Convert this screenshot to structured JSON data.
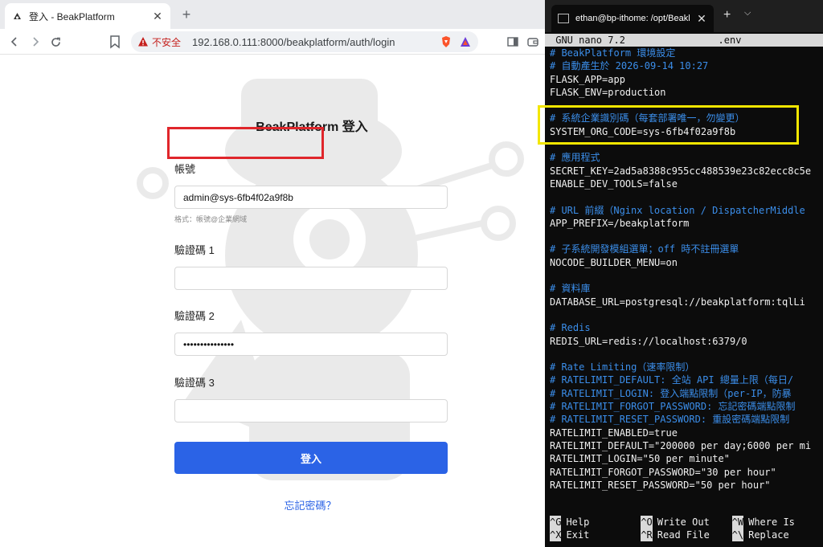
{
  "browser": {
    "tab_title": "登入 - BeakPlatform",
    "tab_close": "✕",
    "new_tab": "+",
    "insecure_label": "不安全",
    "url": "192.168.0.111:8000/beakplatform/auth/login"
  },
  "login": {
    "title": "BeakPlatform 登入",
    "account_label": "帳號",
    "account_value": "admin@sys-6fb4f02a9f8b",
    "account_hint": "格式：帳號@企業網域",
    "code1_label": "驗證碼 1",
    "code1_value": "",
    "code2_label": "驗證碼 2",
    "code2_value": "•••••••••••••••",
    "code3_label": "驗證碼 3",
    "code3_value": "",
    "submit_label": "登入",
    "forgot_label": "忘記密碼？"
  },
  "terminal": {
    "tab_title": "ethan@bp-ithome: /opt/Beakl",
    "tab_close": "✕",
    "new_tab": "+",
    "dropdown": "⌵",
    "nano_header": " GNU nano 7.2                .env",
    "lines": [
      {
        "text": "# BeakPlatform 環境設定",
        "kind": "comment"
      },
      {
        "text": "# 自動產生於 2026-09-14 10:27",
        "kind": "comment"
      },
      {
        "text": "FLASK_APP=app",
        "kind": "plain"
      },
      {
        "text": "FLASK_ENV=production",
        "kind": "plain"
      },
      {
        "text": "",
        "kind": "plain"
      },
      {
        "text": "# 系統企業識別碼（每套部署唯一，勿變更）",
        "kind": "comment"
      },
      {
        "text": "SYSTEM_ORG_CODE=sys-6fb4f02a9f8b",
        "kind": "plain"
      },
      {
        "text": "",
        "kind": "plain"
      },
      {
        "text": "# 應用程式",
        "kind": "comment"
      },
      {
        "text": "SECRET_KEY=2ad5a8388c955cc488539e23c82ecc8c5e",
        "kind": "plain"
      },
      {
        "text": "ENABLE_DEV_TOOLS=false",
        "kind": "plain"
      },
      {
        "text": "",
        "kind": "plain"
      },
      {
        "text": "# URL 前綴（Nginx location / DispatcherMiddle",
        "kind": "comment"
      },
      {
        "text": "APP_PREFIX=/beakplatform",
        "kind": "plain"
      },
      {
        "text": "",
        "kind": "plain"
      },
      {
        "text": "# 子系統開發模組選單；off 時不註冊選單",
        "kind": "comment"
      },
      {
        "text": "NOCODE_BUILDER_MENU=on",
        "kind": "plain"
      },
      {
        "text": "",
        "kind": "plain"
      },
      {
        "text": "# 資料庫",
        "kind": "comment"
      },
      {
        "text": "DATABASE_URL=postgresql://beakplatform:tqlLi",
        "kind": "plain"
      },
      {
        "text": "",
        "kind": "plain"
      },
      {
        "text": "# Redis",
        "kind": "comment"
      },
      {
        "text": "REDIS_URL=redis://localhost:6379/0",
        "kind": "plain"
      },
      {
        "text": "",
        "kind": "plain"
      },
      {
        "text": "# Rate Limiting（速率限制）",
        "kind": "comment"
      },
      {
        "text": "# RATELIMIT_DEFAULT: 全站 API 總量上限（每日/",
        "kind": "comment"
      },
      {
        "text": "# RATELIMIT_LOGIN: 登入端點限制（per-IP，防暴",
        "kind": "comment"
      },
      {
        "text": "# RATELIMIT_FORGOT_PASSWORD: 忘記密碼端點限制",
        "kind": "comment"
      },
      {
        "text": "# RATELIMIT_RESET_PASSWORD: 重設密碼端點限制",
        "kind": "comment"
      },
      {
        "text": "RATELIMIT_ENABLED=true",
        "kind": "plain"
      },
      {
        "text": "RATELIMIT_DEFAULT=\"200000 per day;6000 per mi",
        "kind": "plain"
      },
      {
        "text": "RATELIMIT_LOGIN=\"50 per minute\"",
        "kind": "plain"
      },
      {
        "text": "RATELIMIT_FORGOT_PASSWORD=\"30 per hour\"",
        "kind": "plain"
      },
      {
        "text": "RATELIMIT_RESET_PASSWORD=\"50 per hour\"",
        "kind": "plain"
      }
    ],
    "footer_rows": [
      [
        {
          "key": "^G",
          "label": "Help"
        },
        {
          "key": "^O",
          "label": "Write Out"
        },
        {
          "key": "^W",
          "label": "Where Is"
        }
      ],
      [
        {
          "key": "^X",
          "label": "Exit"
        },
        {
          "key": "^R",
          "label": "Read File"
        },
        {
          "key": "^\\",
          "label": "Replace"
        }
      ]
    ]
  },
  "colors": {
    "accent": "#2b63e6",
    "highlight_red": "#e0262b",
    "highlight_yellow": "#f3e600",
    "nano_comment": "#3b8eea"
  }
}
